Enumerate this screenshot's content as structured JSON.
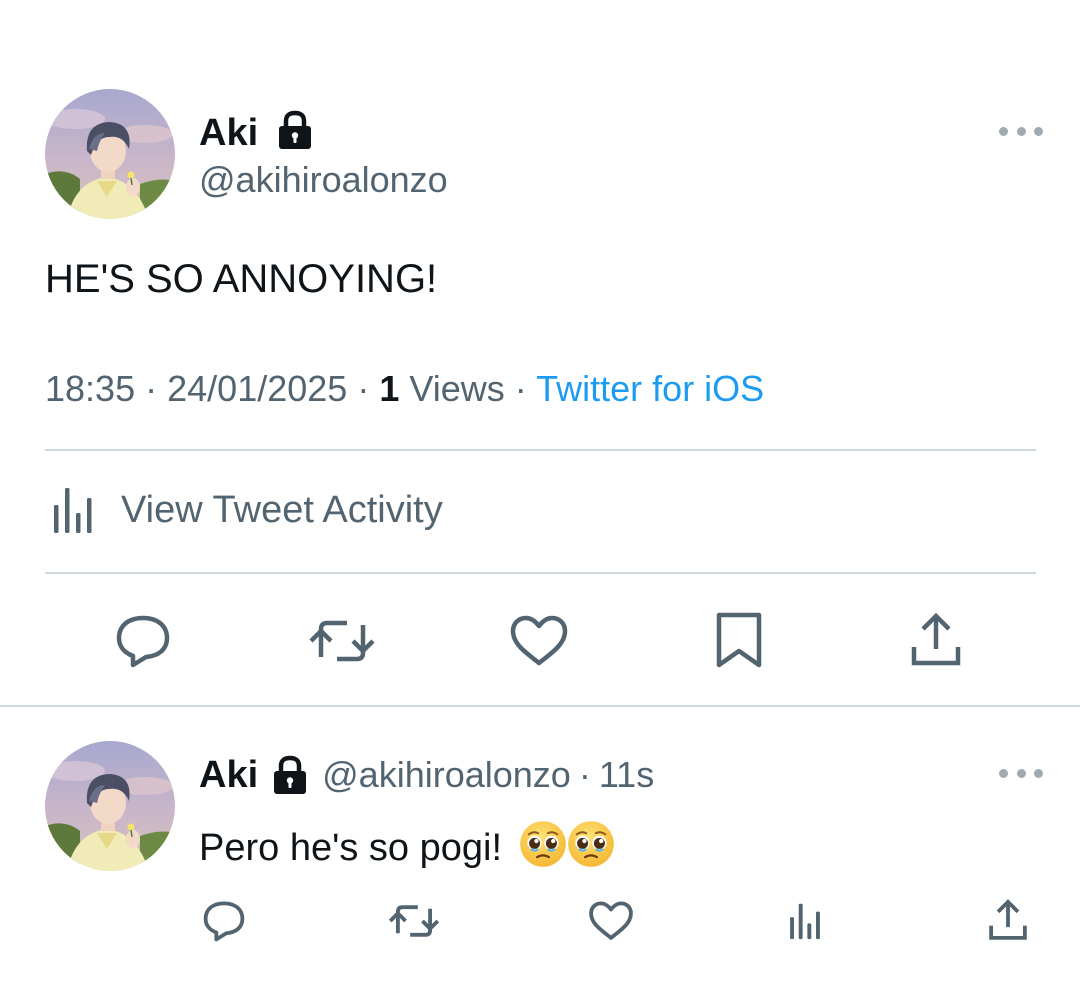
{
  "colors": {
    "text_primary": "#0f1419",
    "text_secondary": "#536471",
    "link": "#1d9bf0",
    "divider": "#cfd9de",
    "icon": "#536471"
  },
  "main_tweet": {
    "author_name": "Aki",
    "author_handle": "@akihiroalonzo",
    "protected_icon": "lock-icon",
    "text": "HE'S SO ANNOYING!",
    "time": "18:35",
    "separator": "·",
    "date": "24/01/2025",
    "views_count": "1",
    "views_label": "Views",
    "source": "Twitter for iOS",
    "activity_label": "View Tweet Activity",
    "actions": [
      "reply-icon",
      "retweet-icon",
      "like-icon",
      "bookmark-icon",
      "share-icon"
    ]
  },
  "reply": {
    "author_name": "Aki",
    "author_handle": "@akihiroalonzo",
    "separator": "·",
    "age": "11s",
    "text": "Pero he's so pogi!",
    "emojis": [
      "pleading-face-emoji",
      "pleading-face-emoji"
    ],
    "actions": [
      "reply-icon",
      "retweet-icon",
      "like-icon",
      "analytics-icon",
      "share-icon"
    ]
  }
}
